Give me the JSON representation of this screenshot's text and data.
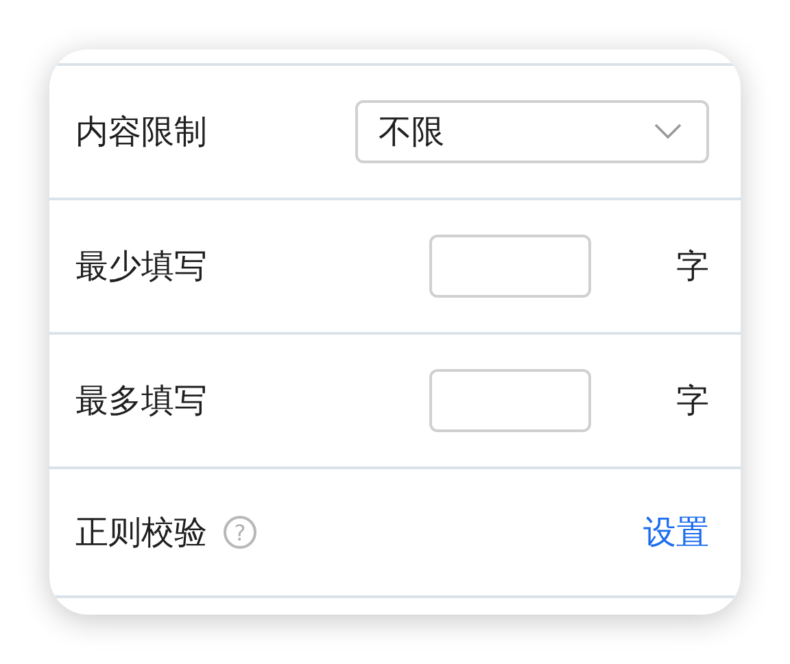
{
  "rows": [
    {
      "kind": "select",
      "label": "内容限制",
      "value": "不限"
    },
    {
      "kind": "number",
      "label": "最少填写",
      "unit": "字"
    },
    {
      "kind": "number",
      "label": "最多填写",
      "unit": "字"
    },
    {
      "kind": "link",
      "label": "正则校验",
      "help": "?",
      "link": "设置"
    }
  ]
}
